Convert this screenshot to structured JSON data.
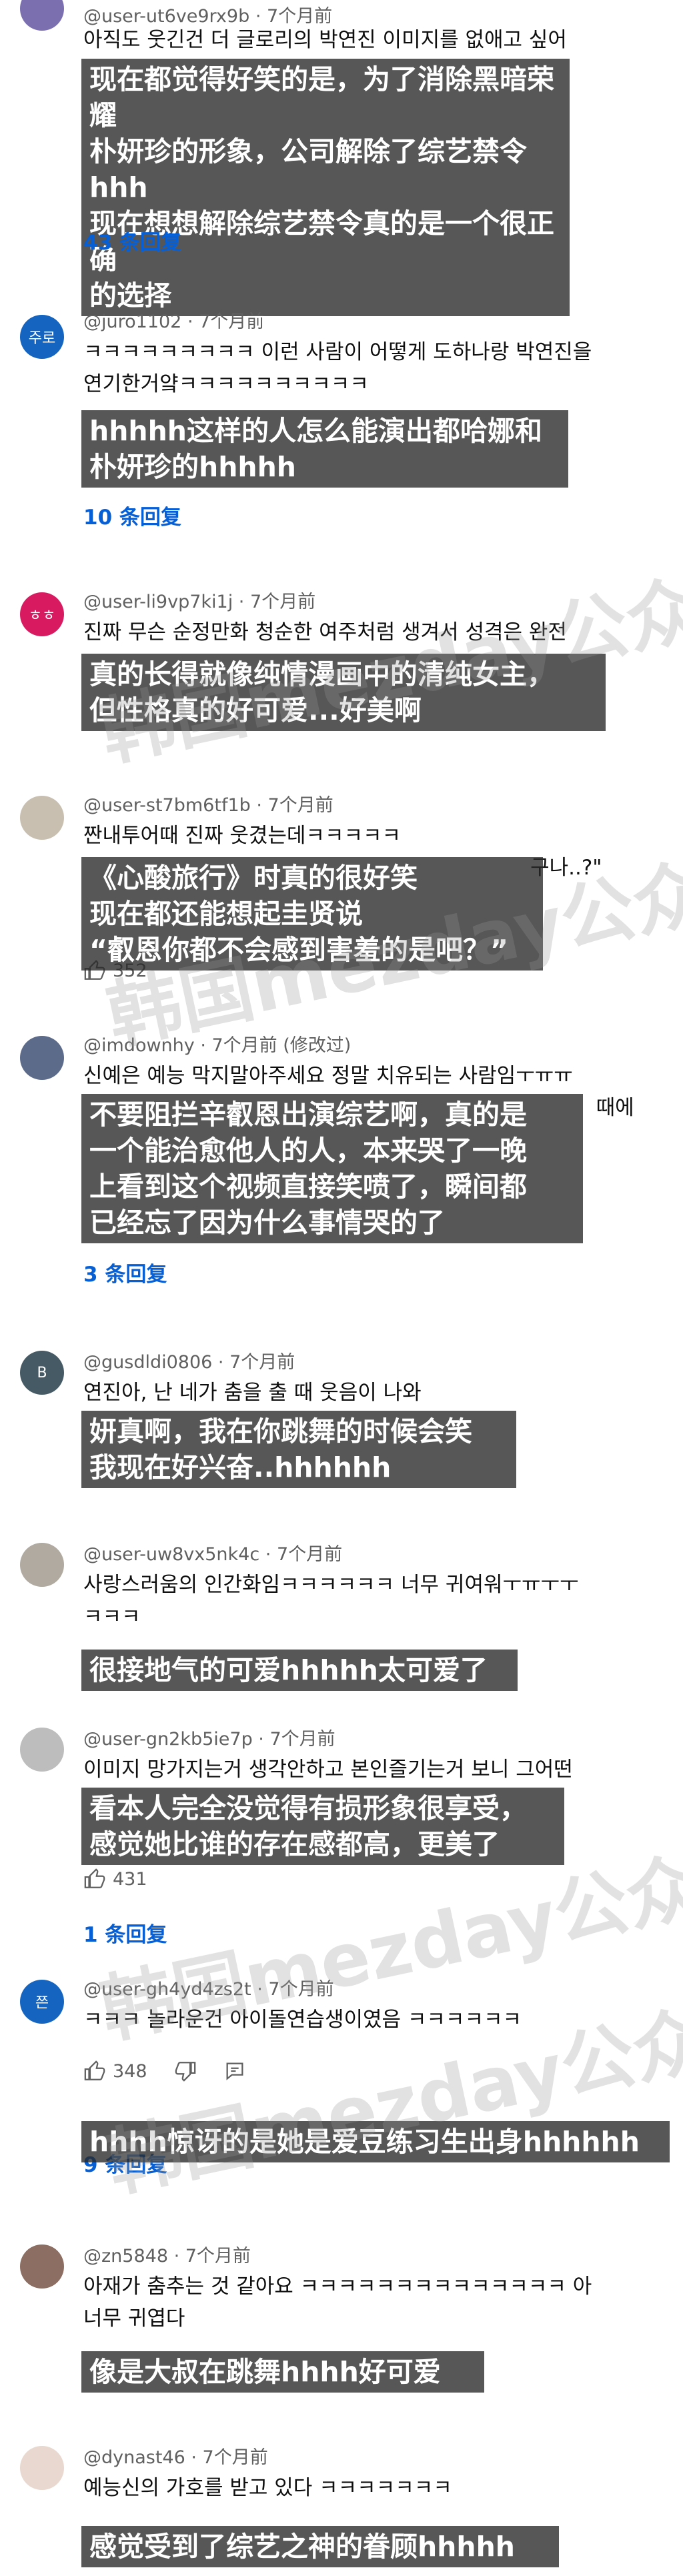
{
  "comments": [
    {
      "avatar": {
        "initial": "",
        "color": "#7b6fb0"
      },
      "user": "@user-ut6ve9rx9b",
      "time": "7个月前",
      "text": "아직도 웃긴건 더 글로리의 박연진 이미지를 없애고 싶어",
      "overlay": "现在都觉得好笑的是，为了消除黑暗荣耀\n朴妍珍的形象，公司解除了综艺禁令hhh\n现在想想解除综艺禁令真的是一个很正确\n的选择",
      "replies": "43 条回复"
    },
    {
      "avatar": {
        "initial": "주로",
        "color": "#1565c0"
      },
      "user": "@juro1102",
      "time": "7个月前",
      "text": "ㅋㅋㅋㅋㅋㅋㅋㅋㅋ 이런 사람이 어떻게 도하나랑 박연진을\n연기한거얔ㅋㅋㅋㅋㅋㅋㅋㅋㅋㅋ",
      "overlay": "hhhhh这样的人怎么能演出都哈娜和\n朴妍珍的hhhhh",
      "replies": "10 条回复"
    },
    {
      "avatar": {
        "initial": "ㅎㅎ",
        "color": "#d81b60"
      },
      "user": "@user-li9vp7ki1j",
      "time": "7个月前",
      "text": "진짜 무슨 순정만화 청순한 여주처럼 생겨서 성격은 완전",
      "overlay": "真的长得就像纯情漫画中的清纯女主，\n但性格真的好可爱...好美啊",
      "replies": ""
    },
    {
      "avatar": {
        "initial": "",
        "color": "#c8bfb0"
      },
      "user": "@user-st7bm6tf1b",
      "time": "7个月前",
      "text": "짠내투어때 진짜 웃겼는데ㅋㅋㅋㅋㅋ\n                                                                    구나..?\"",
      "overlay": "《心酸旅行》时真的很好笑\n现在都还能想起圭贤说\n“叡恩你都不会感到害羞的是吧？”",
      "likes": "352",
      "replies": ""
    },
    {
      "avatar": {
        "initial": "",
        "color": "#5d6b8a"
      },
      "user": "@imdownhy",
      "time": "7个月前 (修改过)",
      "text": "신예은 예능 막지말아주세요 정말 치유되는 사람임ㅜㅠㅠ\n                                                                              때에",
      "overlay": "不要阻拦辛叡恩出演综艺啊，真的是\n一个能治愈他人的人，本来哭了一晚\n上看到这个视频直接笑喷了，瞬间都\n已经忘了因为什么事情哭的了",
      "replies": "3 条回复"
    },
    {
      "avatar": {
        "initial": "B",
        "color": "#455a64"
      },
      "user": "@gusdldi0806",
      "time": "7个月前",
      "text": "연진아, 난 네가 춤을 출 때 웃음이 나와",
      "overlay": "妍真啊，我在你跳舞的时候会笑\n我现在好兴奋..hhhhhh",
      "replies": ""
    },
    {
      "avatar": {
        "initial": "",
        "color": "#b0aaa0"
      },
      "user": "@user-uw8vx5nk4c",
      "time": "7个月前",
      "text": "사랑스러움의 인간화임ㅋㅋㅋㅋㅋㅋ 너무 귀여워ㅜㅠㅜㅜ\nㅋㅋㅋ",
      "overlay": "很接地气的可爱hhhhh太可爱了",
      "replies": ""
    },
    {
      "avatar": {
        "initial": "",
        "color": "#bdbdbd"
      },
      "user": "@user-gn2kb5ie7p",
      "time": "7个月前",
      "text": "이미지 망가지는거 생각안하고 본인즐기는거 보니 그어떤",
      "overlay": "看本人完全没觉得有损形象很享受，\n感觉她比谁的存在感都高，更美了",
      "likes": "431",
      "replies": "1 条回复"
    },
    {
      "avatar": {
        "initial": "쯘",
        "color": "#1565c0"
      },
      "user": "@user-gh4yd4zs2t",
      "time": "7个月前",
      "text": "ㅋㅋㅋ 놀라운건 아이돌연습생이였음 ㅋㅋㅋㅋㅋㅋ",
      "likes": "348",
      "overlay": "hhhh惊讶的是她是爱豆练习生出身hhhhhh",
      "replies": "9 条回复"
    },
    {
      "avatar": {
        "initial": "",
        "color": "#8d6e63"
      },
      "user": "@zn5848",
      "time": "7个月前",
      "text": "아재가 춤추는 것 같아요 ㅋㅋㅋㅋㅋㅋㅋㅋㅋㅋㅋㅋㅋㅋ 아\n너무 귀엽다",
      "overlay": "像是大叔在跳舞hhhh好可爱",
      "replies": ""
    },
    {
      "avatar": {
        "initial": "",
        "color": "#e8d8cf"
      },
      "user": "@dynast46",
      "time": "7个月前",
      "text": "예능신의 가호를 받고 있다 ㅋㅋㅋㅋㅋㅋㅋ",
      "overlay": "感觉受到了综艺之神的眷顾hhhhh",
      "replies": ""
    }
  ],
  "watermarks": [
    "韩国mezday公众号",
    "韩国mezday公众号",
    "韩国mezday公众号",
    "韩国mezday公众号"
  ]
}
